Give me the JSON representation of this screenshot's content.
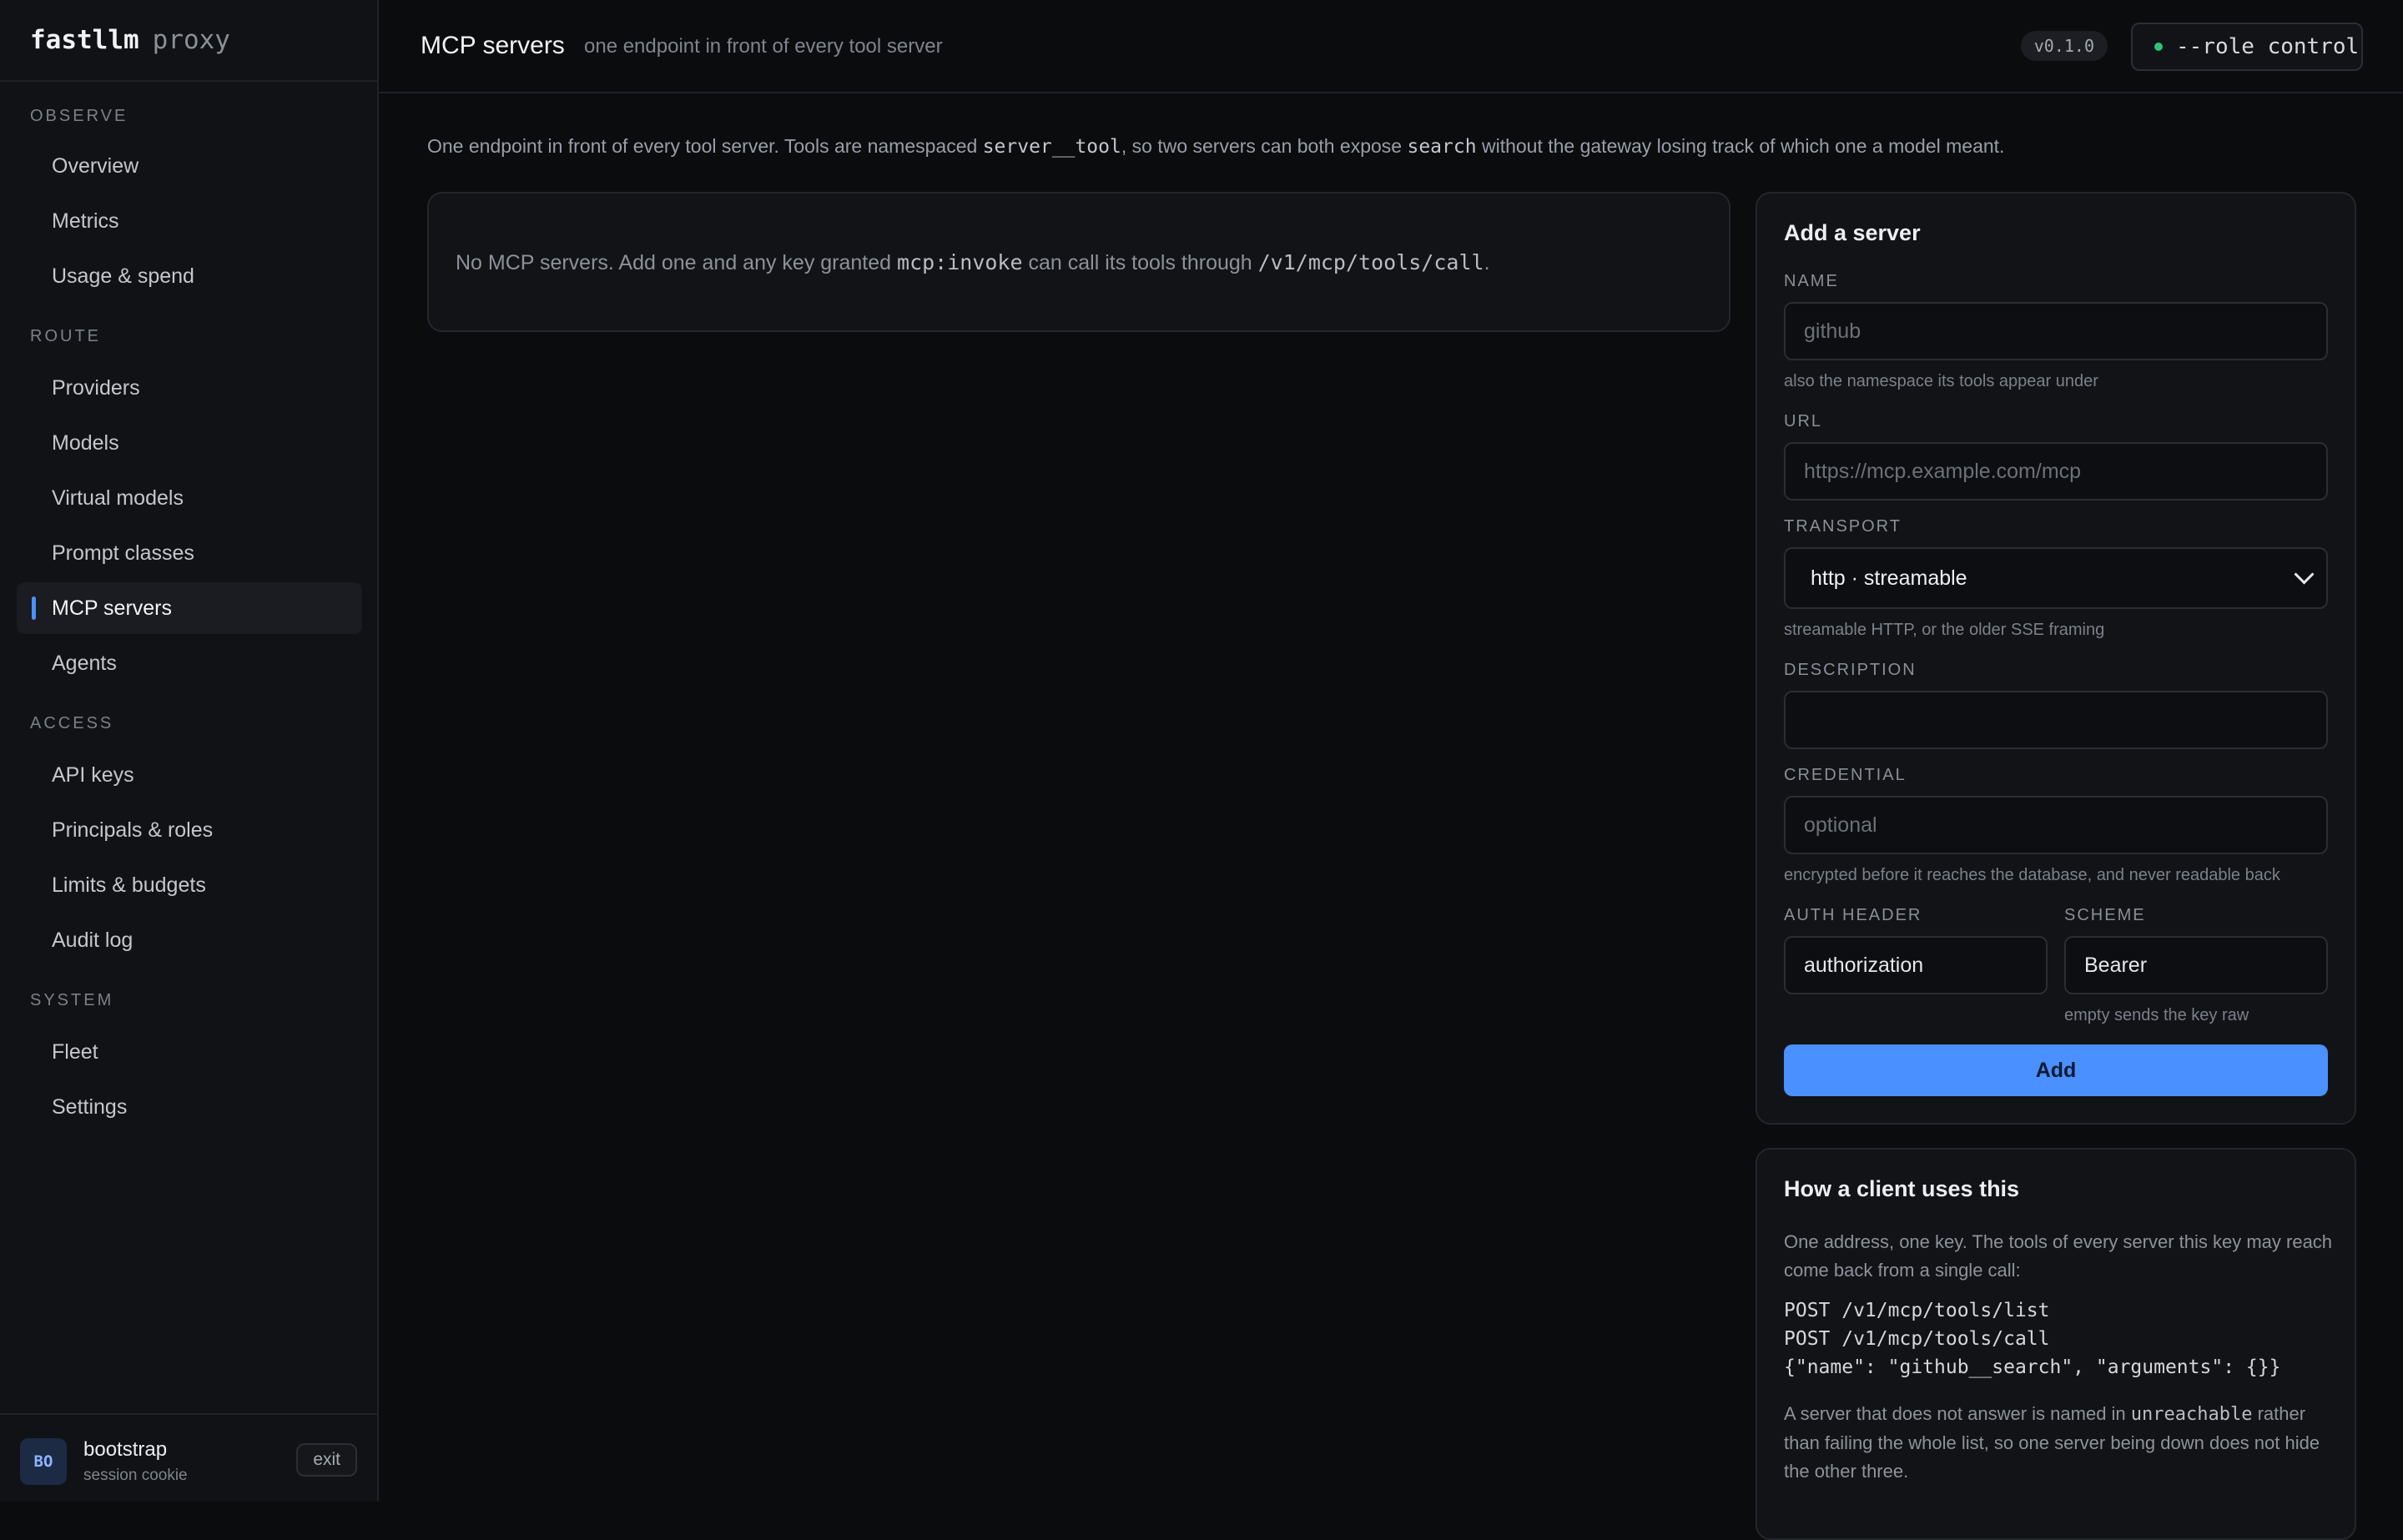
{
  "brand": {
    "name": "fastllm",
    "suffix": "proxy"
  },
  "sidebar": {
    "sections": [
      {
        "label": "OBSERVE"
      },
      {
        "label": "ROUTE"
      },
      {
        "label": "ACCESS"
      },
      {
        "label": "SYSTEM"
      }
    ],
    "items": [
      {
        "label": "Overview"
      },
      {
        "label": "Metrics"
      },
      {
        "label": "Usage & spend"
      },
      {
        "label": "Providers"
      },
      {
        "label": "Models"
      },
      {
        "label": "Virtual models"
      },
      {
        "label": "Prompt classes"
      },
      {
        "label": "MCP servers",
        "active": true
      },
      {
        "label": "Agents"
      },
      {
        "label": "API keys"
      },
      {
        "label": "Principals & roles"
      },
      {
        "label": "Limits & budgets"
      },
      {
        "label": "Audit log"
      },
      {
        "label": "Fleet"
      },
      {
        "label": "Settings"
      }
    ]
  },
  "user": {
    "initials": "BO",
    "name": "bootstrap",
    "subtitle": "session cookie",
    "exit_label": "exit"
  },
  "header": {
    "title": "MCP servers",
    "subtitle": "one endpoint in front of every tool server",
    "version": "v0.1.0",
    "role": "--role control"
  },
  "intro": {
    "part1": "One endpoint in front of every tool server. Tools are namespaced ",
    "code1": "server__tool",
    "part2": ", so two servers can both expose ",
    "code2": "search",
    "part3": " without the gateway losing track of which one a model meant."
  },
  "empty_state": {
    "part1": "No MCP servers. Add one and any key granted ",
    "code1": "mcp:invoke",
    "part2": " can call its tools through ",
    "code2": "/v1/mcp/tools/call",
    "part3": "."
  },
  "form": {
    "title": "Add a server",
    "name": {
      "label": "NAME",
      "placeholder": "github",
      "value": "",
      "hint": "also the namespace its tools appear under"
    },
    "url": {
      "label": "URL",
      "placeholder": "https://mcp.example.com/mcp",
      "value": ""
    },
    "transport": {
      "label": "TRANSPORT",
      "value": "http · streamable",
      "hint": "streamable HTTP, or the older SSE framing"
    },
    "description": {
      "label": "DESCRIPTION",
      "placeholder": "",
      "value": ""
    },
    "credential": {
      "label": "CREDENTIAL",
      "placeholder": "optional",
      "value": "",
      "hint": "encrypted before it reaches the database, and never readable back"
    },
    "auth_header": {
      "label": "AUTH HEADER",
      "value": "authorization"
    },
    "scheme": {
      "label": "SCHEME",
      "value": "Bearer",
      "hint": "empty sends the key raw"
    },
    "submit_label": "Add"
  },
  "client": {
    "title": "How a client uses this",
    "description": "One address, one key. The tools of every server this key may reach come back from a single call:",
    "code_lines": [
      "POST /v1/mcp/tools/list",
      "POST /v1/mcp/tools/call",
      "{\"name\": \"github__search\", \"arguments\": {}}"
    ],
    "note_part1": "A server that does not answer is named in ",
    "note_code": "unreachable",
    "note_part2": " rather than failing the whole list, so one server being down does not hide the other three."
  },
  "colors": {
    "accent": "#4a90ff",
    "status_ok": "#2ec27e",
    "background": "#0b0c0e",
    "panel": "#121317"
  }
}
